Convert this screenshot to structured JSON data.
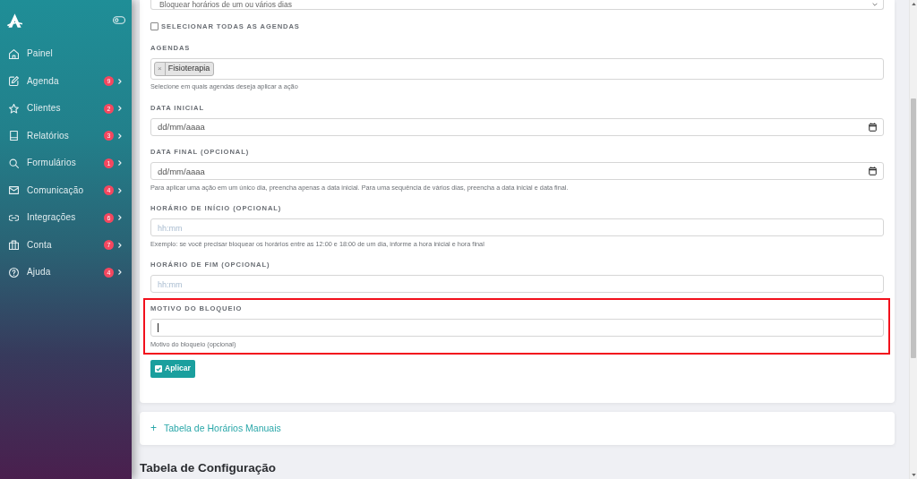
{
  "sidebar": {
    "items": [
      {
        "label": "Painel",
        "submenu": false
      },
      {
        "label": "Agenda",
        "badge": "9",
        "submenu": true
      },
      {
        "label": "Clientes",
        "badge": "2",
        "submenu": true
      },
      {
        "label": "Relatórios",
        "badge": "3",
        "submenu": true
      },
      {
        "label": "Formulários",
        "badge": "1",
        "submenu": true
      },
      {
        "label": "Comunicação",
        "badge": "4",
        "submenu": true
      },
      {
        "label": "Integrações",
        "badge": "6",
        "submenu": true
      },
      {
        "label": "Conta",
        "badge": "7",
        "submenu": true
      },
      {
        "label": "Ajuda",
        "badge": "4",
        "submenu": true
      }
    ]
  },
  "form": {
    "fields": [
      {
        "kind": "select",
        "value": "Bloquear horários de um ou vários dias"
      },
      {
        "kind": "checkbox",
        "label": "SELECIONAR TODAS AS AGENDAS",
        "checked": false
      },
      {
        "kind": "tags",
        "label": "AGENDAS",
        "tags": [
          {
            "label": "Fisioterapia",
            "remove": "×"
          }
        ],
        "help": "Selecione em quais agendas deseja aplicar a ação"
      },
      {
        "kind": "date",
        "label": "DATA INICIAL",
        "placeholder": "dd/mm/aaaa"
      },
      {
        "kind": "date",
        "label": "DATA FINAL (OPCIONAL)",
        "placeholder": "dd/mm/aaaa",
        "help": "Para aplicar uma ação em um único dia, preencha apenas a data inicial. Para uma sequência de vários dias, preencha a data inicial e data final."
      },
      {
        "kind": "time",
        "label": "HORÁRIO DE INÍCIO (OPCIONAL)",
        "placeholder": "hh:mm",
        "help": "Exemplo: se você precisar bloquear os horários entre as 12:00 e 18:00 de um dia, informe a hora inicial e hora final"
      },
      {
        "kind": "time",
        "label": "HORÁRIO DE FIM (OPCIONAL)",
        "placeholder": "hh:mm"
      },
      {
        "kind": "text",
        "label": "MOTIVO DO BLOQUEIO",
        "focused": true,
        "highlighted": true,
        "help": "Motivo do bloqueio (opcional)"
      }
    ],
    "submit": {
      "label": "Aplicar"
    }
  },
  "collapsible": {
    "toggle": "+",
    "title": "Tabela de Horários Manuais"
  },
  "heading": "Tabela de Configuração"
}
